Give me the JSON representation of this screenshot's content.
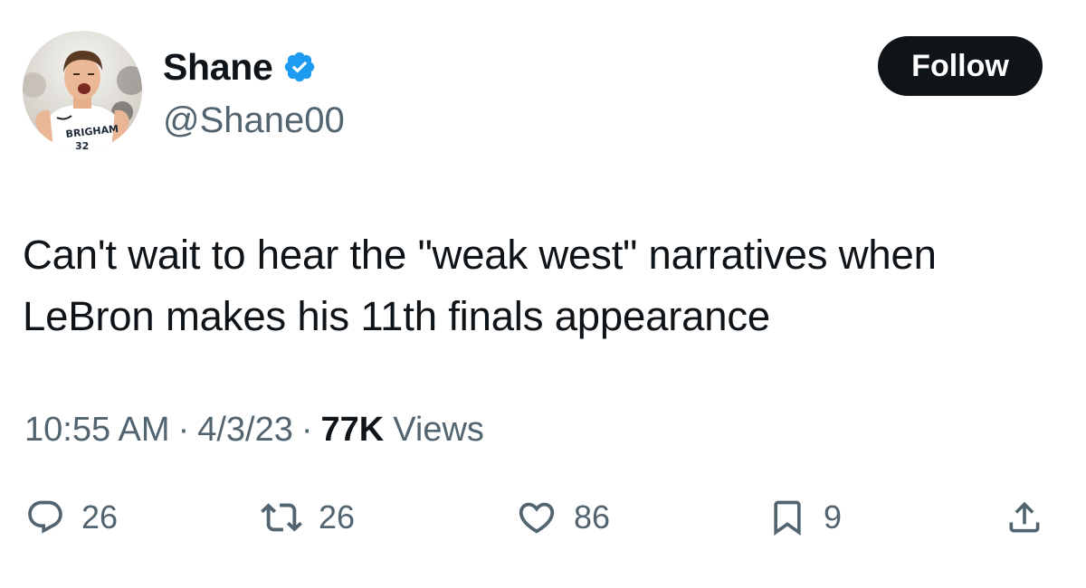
{
  "author": {
    "display_name": "Shane",
    "handle": "@Shane00",
    "verified": true,
    "verified_color": "#1d9bf0",
    "avatar_jersey_text": "BRIGHAM",
    "avatar_jersey_number": "32"
  },
  "follow_button": {
    "label": "Follow",
    "background": "#0f1419"
  },
  "tweet": {
    "text_line1": "Can't wait to hear the \"weak west\" narratives when",
    "text_line2": "LeBron makes his 11th finals appearance"
  },
  "meta": {
    "time": "10:55 AM",
    "separator": "·",
    "date": "4/3/23",
    "views_count": "77K",
    "views_label": "Views"
  },
  "actions": {
    "reply": {
      "icon": "reply-icon",
      "count": "26"
    },
    "retweet": {
      "icon": "retweet-icon",
      "count": "26"
    },
    "like": {
      "icon": "heart-icon",
      "count": "86"
    },
    "bookmark": {
      "icon": "bookmark-icon",
      "count": "9"
    },
    "share": {
      "icon": "share-icon"
    }
  },
  "colors": {
    "text_primary": "#0f1419",
    "text_secondary": "#536471"
  }
}
